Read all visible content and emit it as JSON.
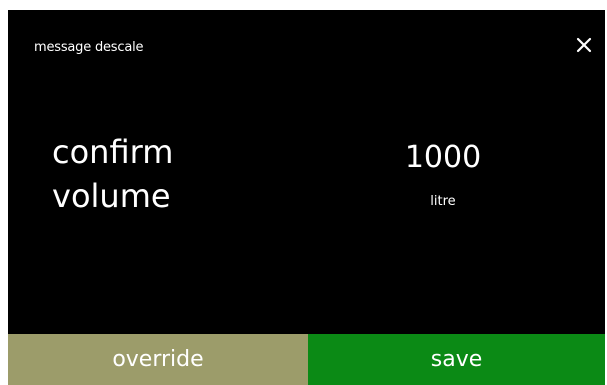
{
  "header": {
    "title": "message descale",
    "close_icon": "close-icon"
  },
  "main": {
    "label_line1": "confirm",
    "label_line2": "volume",
    "value": "1000",
    "unit": "litre"
  },
  "footer": {
    "override_label": "override",
    "save_label": "save"
  },
  "colors": {
    "background": "#000000",
    "override_button": "#9c9c6a",
    "save_button": "#0b8a15",
    "text": "#ffffff"
  }
}
